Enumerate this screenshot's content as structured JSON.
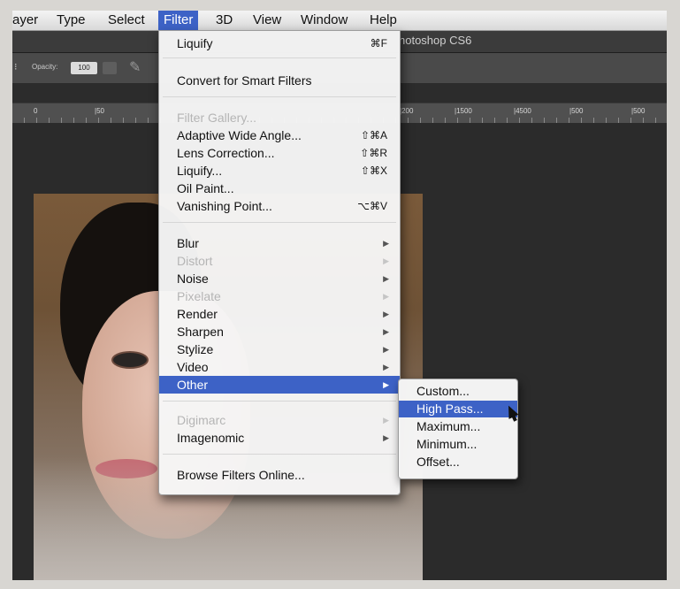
{
  "menubar": {
    "items": [
      "ayer",
      "Type",
      "Select",
      "Filter",
      "3D",
      "View",
      "Window",
      "Help"
    ],
    "active": "Filter"
  },
  "titlebar": {
    "title": "hotoshop CS6"
  },
  "options": {
    "label": "Opacity:",
    "value": "100"
  },
  "ruler": {
    "ticks": [
      "0",
      "|50",
      "|200",
      "|1500",
      "|4500",
      "|500",
      "|500"
    ]
  },
  "filter_menu": {
    "last_filter": {
      "label": "Liquify",
      "shortcut": "⌘F"
    },
    "convert": "Convert for Smart Filters",
    "filter_gallery": "Filter Gallery...",
    "adaptive": {
      "label": "Adaptive Wide Angle...",
      "shortcut": "⇧⌘A"
    },
    "lens": {
      "label": "Lens Correction...",
      "shortcut": "⇧⌘R"
    },
    "liquify": {
      "label": "Liquify...",
      "shortcut": "⇧⌘X"
    },
    "oilpaint": {
      "label": "Oil Paint..."
    },
    "vanishing": {
      "label": "Vanishing Point...",
      "shortcut": "⌥⌘V"
    },
    "blur": "Blur",
    "distort": "Distort",
    "noise": "Noise",
    "pixelate": "Pixelate",
    "render": "Render",
    "sharpen": "Sharpen",
    "stylize": "Stylize",
    "video": "Video",
    "other": "Other",
    "digimarc": "Digimarc",
    "imagenomic": "Imagenomic",
    "browse": "Browse Filters Online..."
  },
  "other_submenu": [
    "Custom...",
    "High Pass...",
    "Maximum...",
    "Minimum...",
    "Offset..."
  ]
}
